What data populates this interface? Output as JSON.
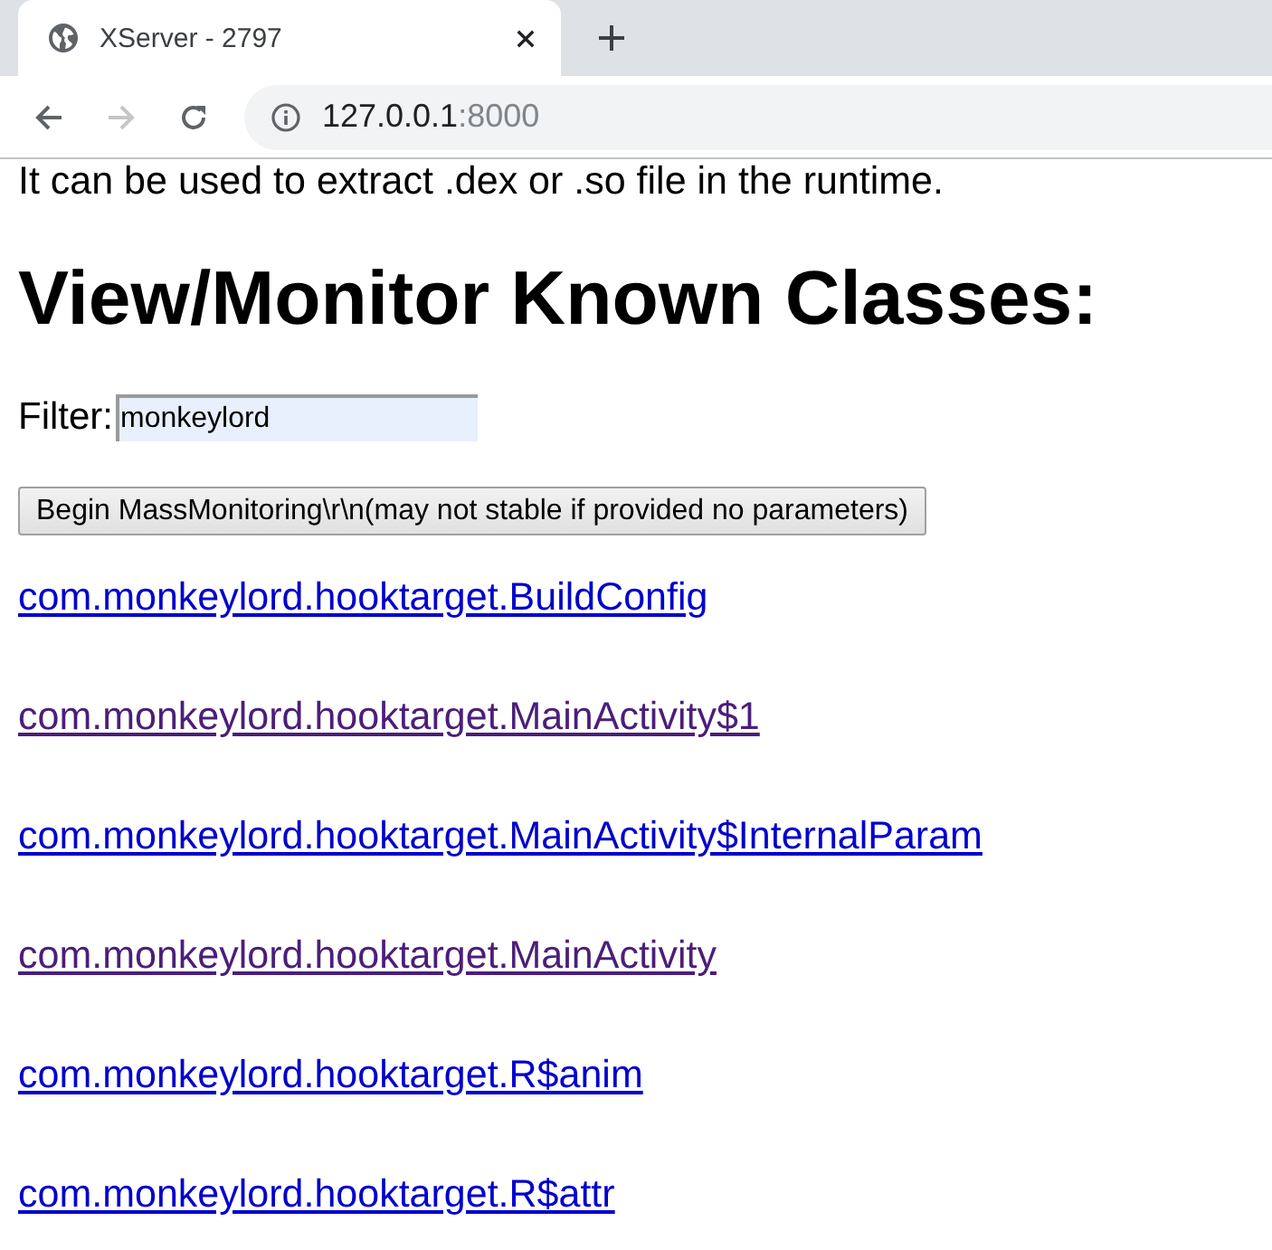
{
  "browser": {
    "tab": {
      "title": "XServer - 2797"
    },
    "nav": {
      "back": {
        "disabled": false
      },
      "forward": {
        "disabled": true
      }
    },
    "address": {
      "host": "127.0.0.1",
      "port": ":8000"
    }
  },
  "page": {
    "intro": "It can be used to extract .dex or .so file in the runtime.",
    "heading": "View/Monitor Known Classes:",
    "filter": {
      "label": "Filter:",
      "value": "monkeylord"
    },
    "button": "Begin MassMonitoring\\r\\n(may not stable if provided no parameters)",
    "links": [
      {
        "text": "com.monkeylord.hooktarget.BuildConfig",
        "visited": false
      },
      {
        "text": "com.monkeylord.hooktarget.MainActivity$1",
        "visited": true
      },
      {
        "text": "com.monkeylord.hooktarget.MainActivity$InternalParam",
        "visited": false
      },
      {
        "text": "com.monkeylord.hooktarget.MainActivity",
        "visited": true
      },
      {
        "text": "com.monkeylord.hooktarget.R$anim",
        "visited": false
      },
      {
        "text": "com.monkeylord.hooktarget.R$attr",
        "visited": false
      }
    ]
  }
}
